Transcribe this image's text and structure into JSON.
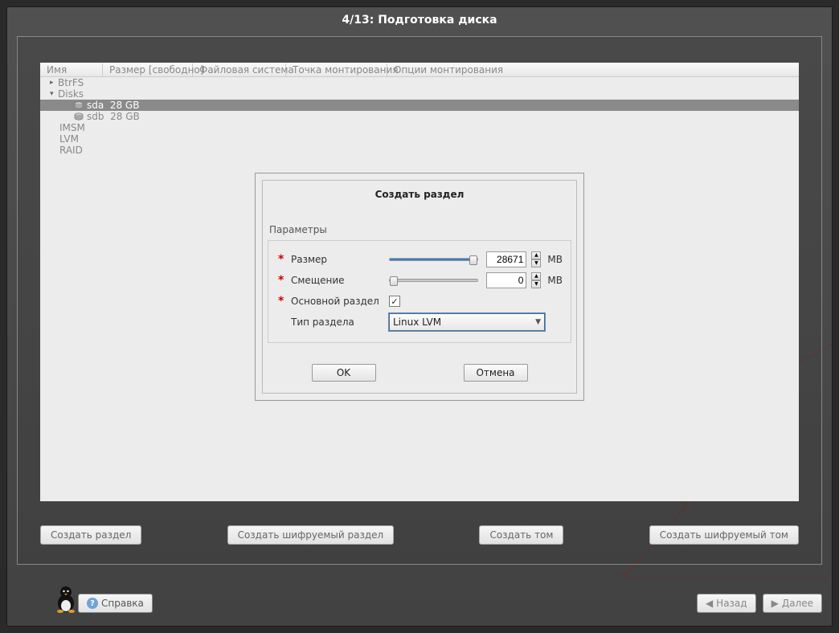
{
  "page_title": "4/13: Подготовка диска",
  "tree": {
    "headers": [
      "Имя",
      "Размер [свободно]",
      "Файловая система",
      "Точка монтирования",
      "Опции монтирования"
    ],
    "rows": [
      {
        "label": "BtrFS",
        "level": 0
      },
      {
        "label": "Disks",
        "level": 0,
        "expander": "▾"
      },
      {
        "label": "sda",
        "size": "28 GB",
        "level": 2,
        "selected": true,
        "disk": true
      },
      {
        "label": "sdb",
        "size": "28 GB",
        "level": 2,
        "disk": true
      },
      {
        "label": "IMSM",
        "level": 1
      },
      {
        "label": "LVM",
        "level": 1
      },
      {
        "label": "RAID",
        "level": 1
      }
    ]
  },
  "actions": {
    "create_partition": "Создать раздел",
    "create_encrypted_partition": "Создать шифруемый раздел",
    "create_volume": "Создать том",
    "create_encrypted_volume": "Создать шифруемый том"
  },
  "dialog": {
    "title": "Создать раздел",
    "params_heading": "Параметры",
    "size_label": "Размер",
    "size_value": "28671",
    "size_unit": "MB",
    "offset_label": "Смещение",
    "offset_value": "0",
    "offset_unit": "MB",
    "primary_label": "Основной раздел",
    "primary_checked": true,
    "type_label": "Тип раздела",
    "type_value": "Linux LVM",
    "ok": "OK",
    "cancel": "Отмена"
  },
  "footer": {
    "help": "Справка",
    "back": "Назад",
    "next": "Далее"
  }
}
